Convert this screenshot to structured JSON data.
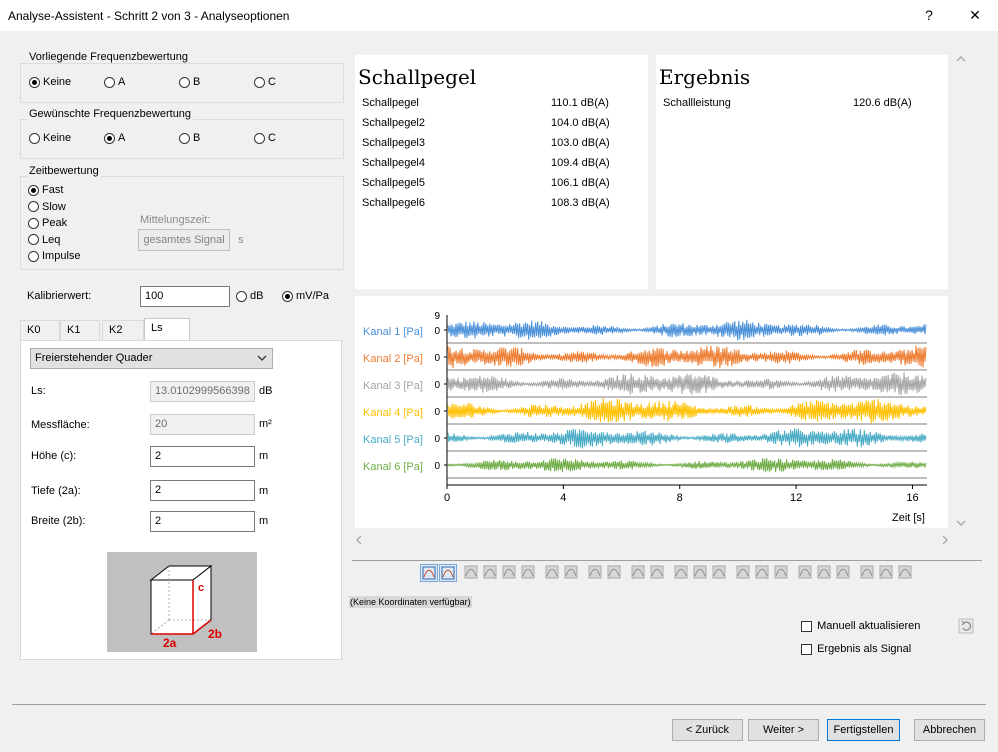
{
  "window": {
    "title": "Analyse-Assistent - Schritt 2 von 3 - Analyseoptionen",
    "help_label": "?",
    "close_label": "✕"
  },
  "vorliegende": {
    "label": "Vorliegende Frequenzbewertung",
    "options": [
      "Keine",
      "A",
      "B",
      "C"
    ],
    "selected": "Keine"
  },
  "gewuenschte": {
    "label": "Gewünschte Frequenzbewertung",
    "options": [
      "Keine",
      "A",
      "B",
      "C"
    ],
    "selected": "A"
  },
  "zeitbewertung": {
    "label": "Zeitbewertung",
    "options": [
      "Fast",
      "Slow",
      "Peak",
      "Leq",
      "Impulse"
    ],
    "selected": "Fast",
    "mittelungszeit_label": "Mittelungszeit:",
    "mittelungszeit_button": "gesamtes Signal",
    "unit": "s"
  },
  "kalibrier": {
    "label": "Kalibrierwert:",
    "value": "100",
    "unit_options": [
      "dB",
      "mV/Pa"
    ],
    "selected_unit": "mV/Pa"
  },
  "tabs": [
    "K0",
    "K1",
    "K2",
    "Ls"
  ],
  "active_tab": "Ls",
  "ls_panel": {
    "dropdown_value": "Freierstehender Quader",
    "fields": [
      {
        "label": "Ls:",
        "value": "13.0102999566398",
        "unit": "dB",
        "disabled": true
      },
      {
        "label": "Messfläche:",
        "value": "20",
        "unit": "m²",
        "disabled": true
      },
      {
        "label": "Höhe (c):",
        "value": "2",
        "unit": "m",
        "disabled": false
      },
      {
        "label": "Tiefe (2a):",
        "value": "2",
        "unit": "m",
        "disabled": false
      },
      {
        "label": "Breite (2b):",
        "value": "2",
        "unit": "m",
        "disabled": false
      }
    ],
    "diagram_labels": {
      "c": "c",
      "a": "2a",
      "b": "2b"
    }
  },
  "schallpegel": {
    "title": "Schallpegel",
    "rows": [
      {
        "name": "Schallpegel",
        "value": "110.1 dB(A)"
      },
      {
        "name": "Schallpegel2",
        "value": "104.0 dB(A)"
      },
      {
        "name": "Schallpegel3",
        "value": "103.0 dB(A)"
      },
      {
        "name": "Schallpegel4",
        "value": "109.4 dB(A)"
      },
      {
        "name": "Schallpegel5",
        "value": "106.1 dB(A)"
      },
      {
        "name": "Schallpegel6",
        "value": "108.3 dB(A)"
      }
    ]
  },
  "ergebnis": {
    "title": "Ergebnis",
    "rows": [
      {
        "name": "Schallleistung",
        "value": "120.6 dB(A)"
      }
    ]
  },
  "chart_data": {
    "type": "line",
    "xlabel": "Zeit [s]",
    "xlim": [
      0,
      16.5
    ],
    "xticks": [
      0,
      4,
      8,
      12,
      16
    ],
    "x_tick_labels": [
      "0",
      "4",
      "8",
      "12",
      "16"
    ],
    "y_top_label": "9",
    "channel_zero_label": "0",
    "series": [
      {
        "name": "Kanal  1 [Pa]",
        "color": "#4a90d9",
        "amplitude": 0.35
      },
      {
        "name": "Kanal  2 [Pa]",
        "color": "#ed7d31",
        "amplitude": 0.42
      },
      {
        "name": "Kanal  3 [Pa]",
        "color": "#a5a5a5",
        "amplitude": 0.4
      },
      {
        "name": "Kanal  4 [Pa]",
        "color": "#ffc000",
        "amplitude": 0.45
      },
      {
        "name": "Kanal  5 [Pa]",
        "color": "#4bacc6",
        "amplitude": 0.35
      },
      {
        "name": "Kanal  6 [Pa]",
        "color": "#70ad47",
        "amplitude": 0.25
      }
    ]
  },
  "status": {
    "coordinates": "(Keine Koordinaten verfügbar)"
  },
  "options": {
    "manuell": "Manuell aktualisieren",
    "ergebnis_signal": "Ergebnis als Signal"
  },
  "footer": {
    "back": "< Zurück",
    "next": "Weiter >",
    "finish": "Fertigstellen",
    "cancel": "Abbrechen"
  }
}
